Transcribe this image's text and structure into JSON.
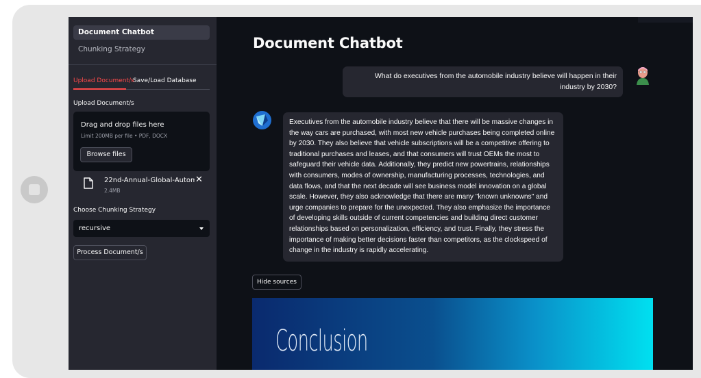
{
  "sidebar": {
    "nav": [
      {
        "label": "Document Chatbot",
        "active": true
      },
      {
        "label": "Chunking Strategy",
        "active": false
      }
    ],
    "tabs": [
      "Upload Document/s",
      "Save/Load Database"
    ],
    "upload_label": "Upload Document/s",
    "dropzone": {
      "title": "Drag and drop files here",
      "limit": "Limit 200MB per file • PDF, DOCX",
      "browse_label": "Browse files"
    },
    "file": {
      "name": "22nd-Annual-Global-Autom...",
      "size": "2.4MB",
      "close_glyph": "✕"
    },
    "strategy_label": "Choose Chunking Strategy",
    "strategy_value": "recursive",
    "process_label": "Process Document/s"
  },
  "main": {
    "title": "Document Chatbot",
    "user_message": "What do executives from the automobile industry believe will happen in their industry by 2030?",
    "bot_message": "Executives from the automobile industry believe that there will be massive changes in the way cars are purchased, with most new vehicle purchases being completed online by 2030. They also believe that vehicle subscriptions will be a competitive offering to traditional purchases and leases, and that consumers will trust OEMs the most to safeguard their vehicle data. Additionally, they predict new powertrains, relationships with consumers, modes of ownership, manufacturing processes, technologies, and data flows, and that the next decade will see business model innovation on a global scale. However, they also acknowledge that there are many \"known unknowns\" and urge companies to prepare for the unexpected. They also emphasize the importance of developing skills outside of current competencies and building direct customer relationships based on personalization, efficiency, and trust. Finally, they stress the importance of making better decisions faster than competitors, as the clockspeed of change in the industry is rapidly accelerating.",
    "hide_sources_label": "Hide sources",
    "source_title": "Conclusion"
  },
  "icons": {
    "file": "file-icon",
    "close": "close-icon",
    "dropdown": "chevron-down-icon",
    "user_avatar": "user-avatar-icon",
    "bot_avatar": "bot-avatar-icon"
  },
  "colors": {
    "accent": "#ff4b4b",
    "sidebar_bg": "#262730",
    "main_bg": "#0e1117",
    "bubble_bg": "#262730"
  }
}
